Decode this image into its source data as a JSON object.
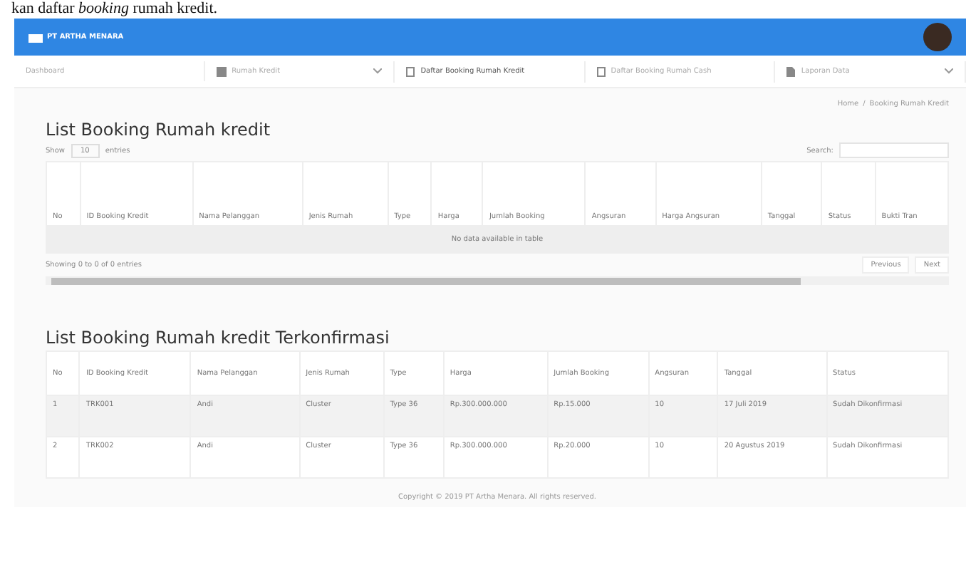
{
  "caption": "kan daftar *booking* rumah kredit.",
  "header": {
    "brand": "PT ARTHA MENARA"
  },
  "nav": [
    {
      "label": "Dashboard",
      "kind": "plain",
      "dropdown": false,
      "selected": false
    },
    {
      "label": "Rumah Kredit",
      "kind": "grid",
      "dropdown": true,
      "selected": false
    },
    {
      "label": "Daftar Booking Rumah Kredit",
      "kind": "doc",
      "dropdown": false,
      "selected": true
    },
    {
      "label": "Daftar Booking Rumah Cash",
      "kind": "doc",
      "dropdown": false,
      "selected": false
    },
    {
      "label": "Laporan Data",
      "kind": "file",
      "dropdown": true,
      "selected": false
    }
  ],
  "breadcrumb": [
    "Home",
    "Booking Rumah Kredit"
  ],
  "breadcrumb_separator": "/",
  "list": {
    "title": "List Booking Rumah kredit",
    "show_label": "Show",
    "show_value": "10",
    "entries_label": "entries",
    "search_label": "Search:",
    "columns": [
      "No",
      "ID Booking Kredit",
      "Nama Pelanggan",
      "Jenis Rumah",
      "Type",
      "Harga",
      "Jumlah Booking",
      "Angsuran",
      "Harga Angsuran",
      "Tanggal",
      "Status",
      "Bukti Tran"
    ],
    "empty": "No data available in table",
    "info": "Showing 0 to 0 of 0 entries",
    "pager": [
      "Previous",
      "Next"
    ]
  },
  "confirmed": {
    "title": "List Booking Rumah kredit Terkonfirmasi",
    "columns": [
      "No",
      "ID Booking Kredit",
      "Nama Pelanggan",
      "Jenis Rumah",
      "Type",
      "Harga",
      "Jumlah Booking",
      "Angsuran",
      "Tanggal",
      "Status"
    ],
    "rows": [
      [
        "1",
        "TRK001",
        "Andi",
        "Cluster",
        "Type 36",
        "Rp.300.000.000",
        "Rp.15.000",
        "10",
        "17 Juli 2019",
        "Sudah Dikonfirmasi"
      ],
      [
        "2",
        "TRK002",
        "Andi",
        "Cluster",
        "Type 36",
        "Rp.300.000.000",
        "Rp.20.000",
        "10",
        "20 Agustus 2019",
        "Sudah Dikonfirmasi"
      ]
    ]
  },
  "footer": "Copyright © 2019 PT Artha Menara. All rights reserved."
}
